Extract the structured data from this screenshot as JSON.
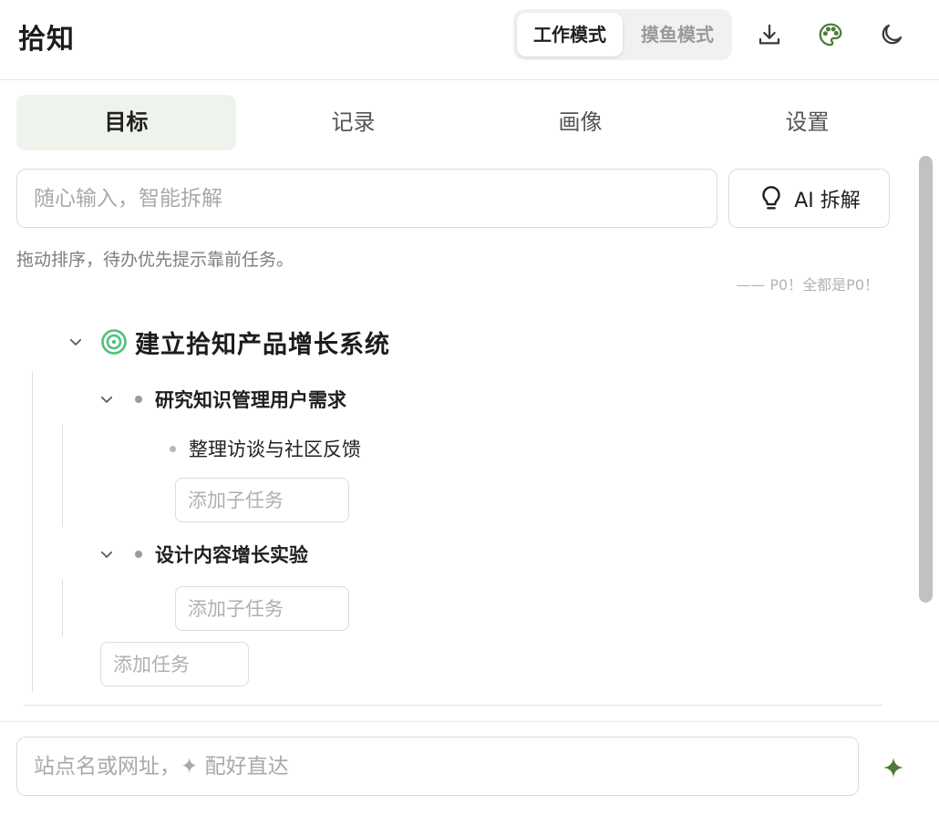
{
  "header": {
    "title": "拾知",
    "modes": {
      "work": "工作模式",
      "fish": "摸鱼模式"
    },
    "accent": "#4a7c3b"
  },
  "tabs": [
    "目标",
    "记录",
    "画像",
    "设置"
  ],
  "goal_input": {
    "placeholder": "随心输入，智能拆解"
  },
  "ai_button": {
    "label": "AI 拆解"
  },
  "hint": "拖动排序，待办优先提示靠前任务。",
  "p0_note": "—— P0！全都是P0！",
  "goal": {
    "title": "建立拾知产品增长系统",
    "subgoals": [
      {
        "title": "研究知识管理用户需求",
        "tasks": [
          "整理访谈与社区反馈"
        ],
        "add_subtask_placeholder": "添加子任务"
      },
      {
        "title": "设计内容增长实验",
        "tasks": [],
        "add_subtask_placeholder": "添加子任务"
      }
    ],
    "add_task_placeholder": "添加任务"
  },
  "footer": {
    "placeholder": "站点名或网址，✦ 配好直达"
  }
}
